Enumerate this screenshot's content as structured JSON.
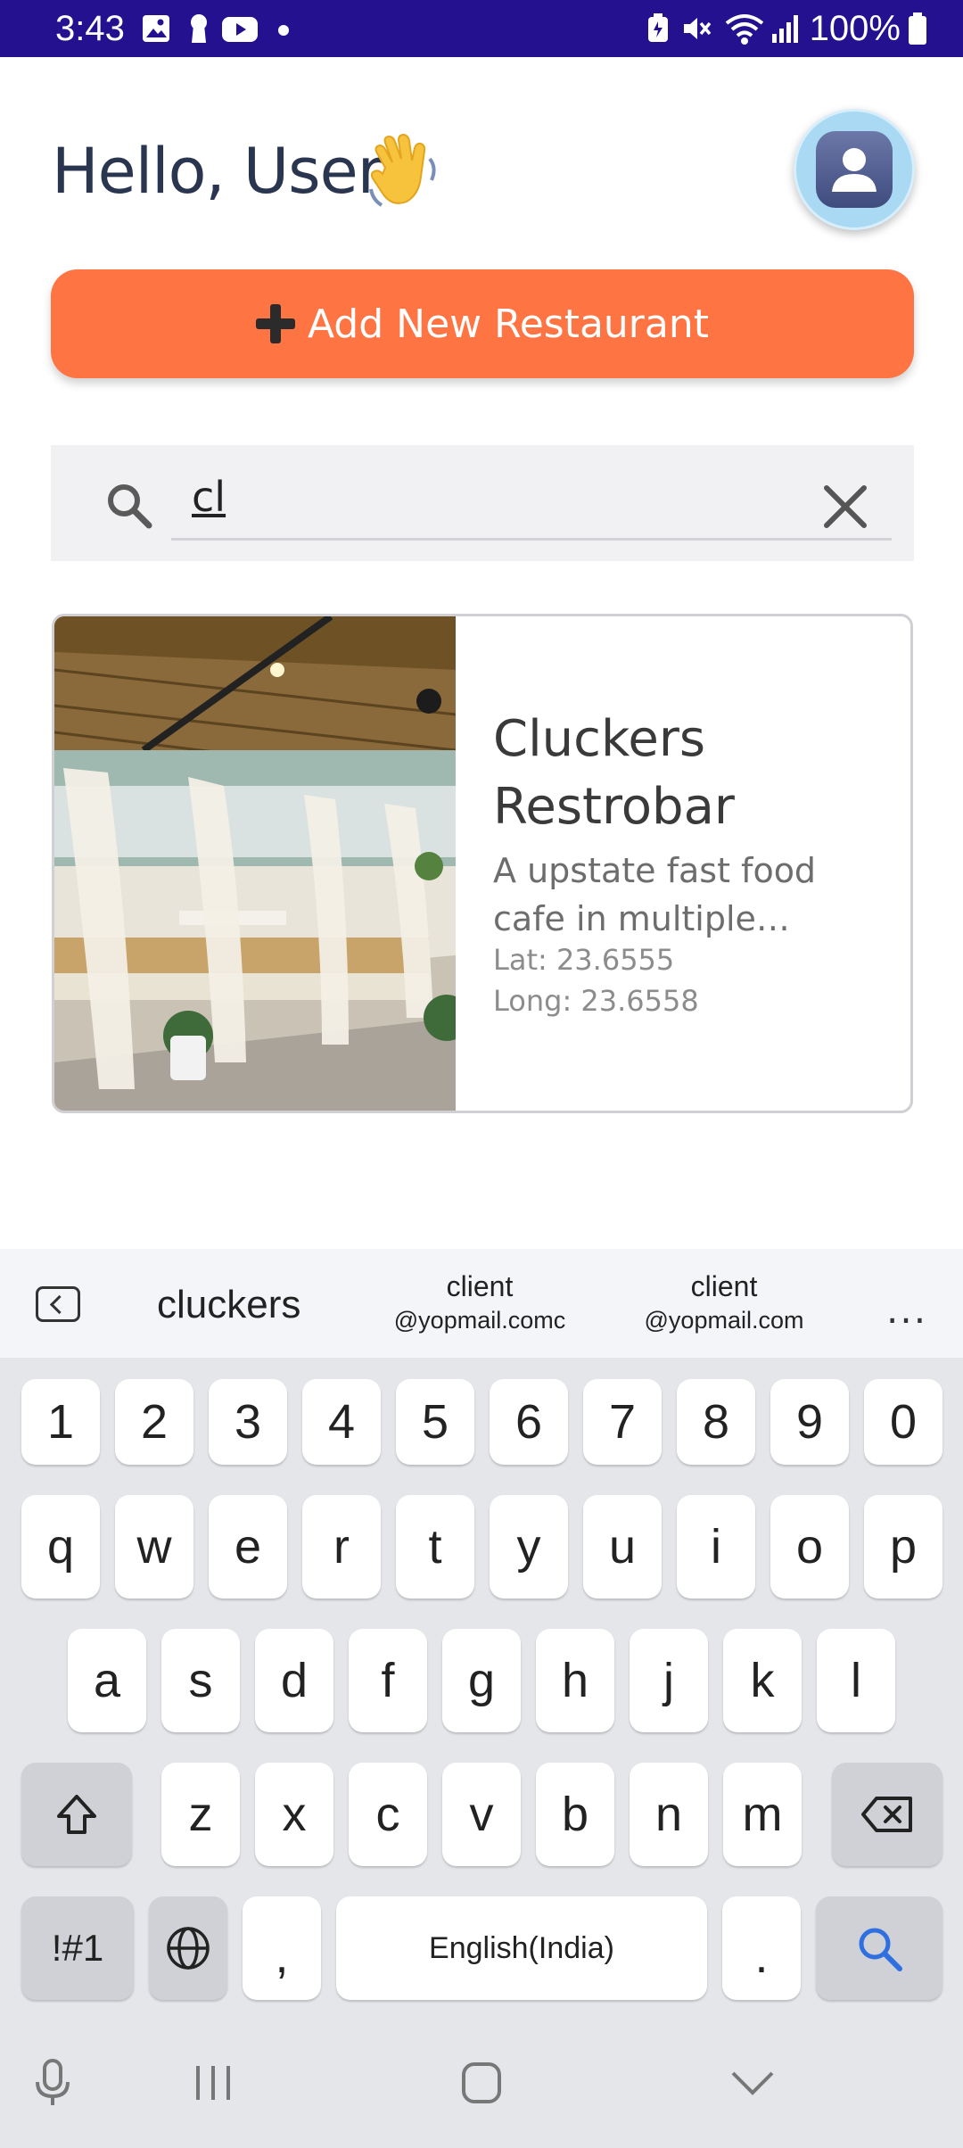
{
  "status_bar": {
    "time": "3:43",
    "battery": "100%"
  },
  "header": {
    "greeting": "Hello, User",
    "avatar_icon": "user-avatar-icon"
  },
  "actions": {
    "add_restaurant_label": "Add New Restaurant"
  },
  "search": {
    "value": "cl",
    "search_icon": "search-icon",
    "clear_icon": "close-icon"
  },
  "results": [
    {
      "name": "Cluckers Restrobar",
      "description": "A upstate fast food cafe in multiple locations a...",
      "lat": "Lat: 23.6555",
      "long": "Long: 23.6558"
    }
  ],
  "keyboard": {
    "suggestions": [
      "cluckers",
      {
        "line1": "client",
        "line2": "@yopmail.comc"
      },
      {
        "line1": "client",
        "line2": "@yopmail.com"
      }
    ],
    "more": "...",
    "row_numbers": [
      "1",
      "2",
      "3",
      "4",
      "5",
      "6",
      "7",
      "8",
      "9",
      "0"
    ],
    "row1": [
      "q",
      "w",
      "e",
      "r",
      "t",
      "y",
      "u",
      "i",
      "o",
      "p"
    ],
    "row2": [
      "a",
      "s",
      "d",
      "f",
      "g",
      "h",
      "j",
      "k",
      "l"
    ],
    "row3": [
      "z",
      "x",
      "c",
      "v",
      "b",
      "n",
      "m"
    ],
    "symbols_key": "!#1",
    "comma_key": ",",
    "space_key": "English(India)",
    "period_key": "."
  },
  "colors": {
    "status_bar": "#24118f",
    "accent_button": "#ff7443",
    "search_bg": "#f1f1f3",
    "search_action_blue": "#2f6fe0"
  }
}
